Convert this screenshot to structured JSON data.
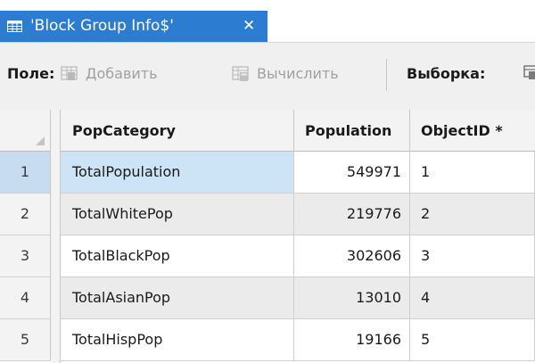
{
  "tab": {
    "title": "'Block Group Info$'",
    "close_symbol": "✕",
    "icon": "table-icon",
    "color": "#2c7cd1"
  },
  "toolbar": {
    "field_label": "Поле:",
    "add_label": "Добавить",
    "add_icon": "add-field-icon",
    "calculate_label": "Вычислить",
    "calculate_icon": "calculate-field-icon",
    "selection_label": "Выборка:",
    "selection_icon": "selection-icon"
  },
  "table": {
    "columns": [
      "PopCategory",
      "Population",
      "ObjectID *"
    ],
    "rows": [
      {
        "num": "1",
        "category": "TotalPopulation",
        "population": "549971",
        "objectid": "1"
      },
      {
        "num": "2",
        "category": "TotalWhitePop",
        "population": "219776",
        "objectid": "2"
      },
      {
        "num": "3",
        "category": "TotalBlackPop",
        "population": "302606",
        "objectid": "3"
      },
      {
        "num": "4",
        "category": "TotalAsianPop",
        "population": "13010",
        "objectid": "4"
      },
      {
        "num": "5",
        "category": "TotalHispPop",
        "population": "19166",
        "objectid": "5"
      }
    ],
    "selected_row": "1"
  }
}
